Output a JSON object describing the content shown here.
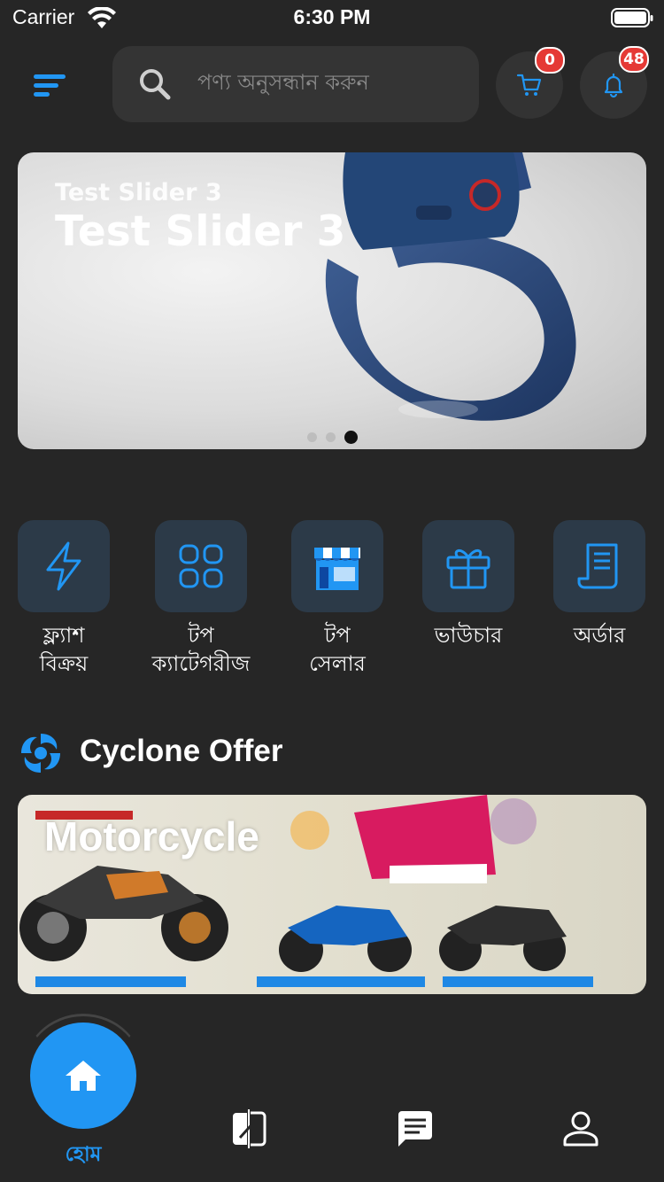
{
  "status_bar": {
    "carrier": "Carrier",
    "time": "6:30 PM"
  },
  "header": {
    "search_placeholder": "পণ্য অনুসন্ধান করুন",
    "cart_count": "0",
    "notification_count": "48"
  },
  "slider": {
    "subtitle": "Test Slider 3",
    "title": "Test Slider 3",
    "page_count": 3,
    "active_index": 2
  },
  "categories": [
    {
      "label": "ফ্ল্যাশ\nবিক্রয়",
      "icon": "flash-icon"
    },
    {
      "label": "টপ\nক্যাটেগরীজ",
      "icon": "grid-icon"
    },
    {
      "label": "টপ\nসেলার",
      "icon": "shop-icon"
    },
    {
      "label": "ভাউচার",
      "icon": "gift-icon"
    },
    {
      "label": "অর্ডার",
      "icon": "receipt-icon"
    }
  ],
  "cyclone": {
    "title": "Cyclone Offer",
    "banner_title": "Motorcycle"
  },
  "bottom_nav": {
    "home_label": "হোম",
    "items": [
      "home-icon",
      "compare-icon",
      "chat-icon",
      "profile-icon"
    ]
  },
  "colors": {
    "background": "#262626",
    "accent": "#2196f3",
    "badge": "#e53935",
    "tile": "#2c3a48"
  }
}
